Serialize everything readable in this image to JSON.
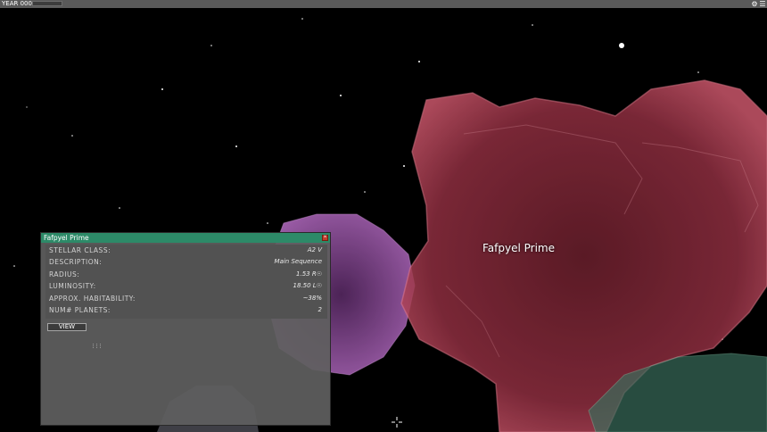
{
  "topbar": {
    "year_label": "YEAR 0000",
    "year_progress": 0,
    "icons": [
      "gear-icon",
      "menu-icon"
    ]
  },
  "scene": {
    "planet_label": "Fafpyel Prime",
    "colors": {
      "space": "#000000",
      "nebula_red": "#b0304a",
      "nebula_pink": "#c070c8",
      "nebula_green": "#4a9a7a",
      "panel_header": "#2d8a68",
      "close_red": "#c23b2a"
    }
  },
  "panel": {
    "title": "Fafpyel Prime",
    "properties": [
      {
        "label": "STELLAR CLASS:",
        "value": "A2 V"
      },
      {
        "label": "DESCRIPTION:",
        "value": "Main Sequence"
      },
      {
        "label": "RADIUS:",
        "value": "1.53 R☉"
      },
      {
        "label": "LUMINOSITY:",
        "value": "18.50 L☉"
      },
      {
        "label": "APPROX. HABITABILITY:",
        "value": "~38%"
      },
      {
        "label": "NUM# PLANETS:",
        "value": "2"
      }
    ],
    "view_label": "VIEW"
  }
}
